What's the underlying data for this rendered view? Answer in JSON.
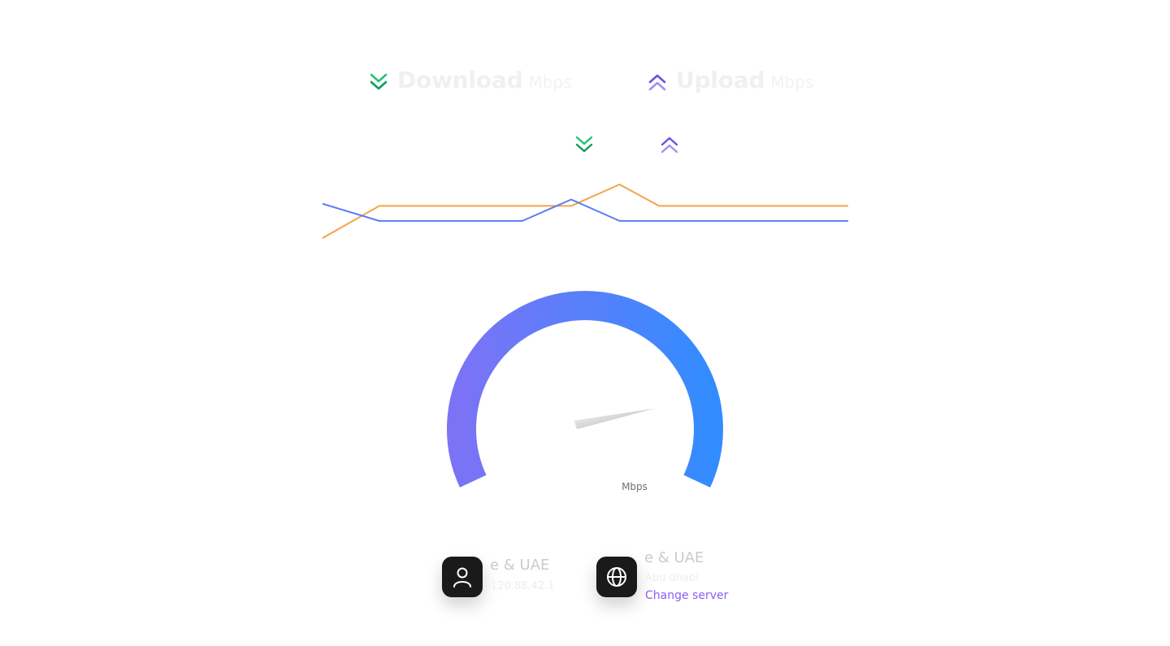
{
  "stats": {
    "download": {
      "label": "Download",
      "unit": "Mbps",
      "icon": "chevron-double-down-icon",
      "color": "#22c37a"
    },
    "upload": {
      "label": "Upload",
      "unit": "Mbps",
      "icon": "chevron-double-up-icon",
      "color": "#8b6cf0"
    }
  },
  "chart_data": {
    "type": "line",
    "x": [
      0,
      1,
      2,
      3,
      4,
      5,
      6,
      7,
      8,
      9
    ],
    "series": [
      {
        "color": "#f5a34a",
        "values": [
          0.0,
          0.6,
          0.6,
          0.6,
          0.6,
          1.0,
          0.6,
          0.6,
          0.6,
          0.6
        ]
      },
      {
        "color": "#5b7cf5",
        "values": [
          0.64,
          0.32,
          0.32,
          0.32,
          0.72,
          0.32,
          0.32,
          0.32,
          0.32,
          0.32
        ]
      }
    ],
    "ylim": [
      0,
      1
    ],
    "grid": false
  },
  "gauge": {
    "unit": "Mbps",
    "fill": 1.0,
    "needle_value": 0.82,
    "colors": {
      "start": "#7b73f6",
      "end": "#338cff"
    }
  },
  "isp": {
    "name": "e & UAE",
    "ip": "120.88.42.1",
    "icon": "user-icon"
  },
  "server": {
    "name": "e & UAE",
    "city": "Abu dhabi",
    "change_label": "Change server",
    "icon": "globe-icon",
    "link_color": "#8b5cf6"
  }
}
